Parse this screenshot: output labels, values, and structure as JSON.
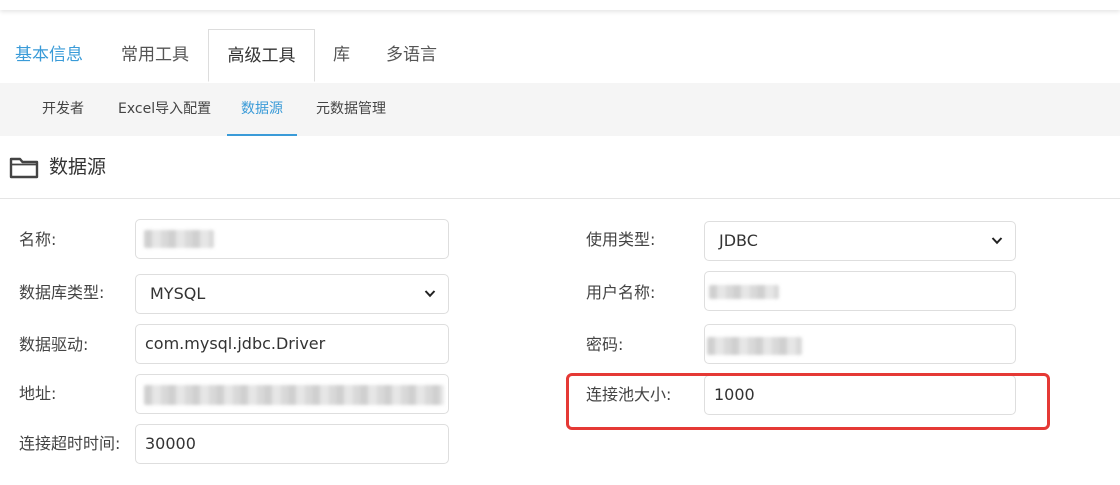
{
  "main_tabs": [
    {
      "label": "基本信息"
    },
    {
      "label": "常用工具"
    },
    {
      "label": "高级工具"
    },
    {
      "label": "库"
    },
    {
      "label": "多语言"
    }
  ],
  "sub_tabs": [
    {
      "label": "开发者"
    },
    {
      "label": "Excel导入配置"
    },
    {
      "label": "数据源"
    },
    {
      "label": "元数据管理"
    }
  ],
  "section": {
    "title": "数据源",
    "icon": "folder-icon"
  },
  "form": {
    "name": {
      "label": "名称:"
    },
    "db_type": {
      "label": "数据库类型:",
      "value": "MYSQL"
    },
    "driver": {
      "label": "数据驱动:",
      "value": "com.mysql.jdbc.Driver"
    },
    "address": {
      "label": "地址:"
    },
    "timeout": {
      "label": "连接超时时间:",
      "value": "30000"
    },
    "use_type": {
      "label": "使用类型:",
      "value": "JDBC"
    },
    "username": {
      "label": "用户名称:"
    },
    "password": {
      "label": "密码:"
    },
    "pool_size": {
      "label": "连接池大小:",
      "value": "1000"
    }
  },
  "colors": {
    "accent": "#3a9bd8",
    "highlight": "#e53935"
  }
}
